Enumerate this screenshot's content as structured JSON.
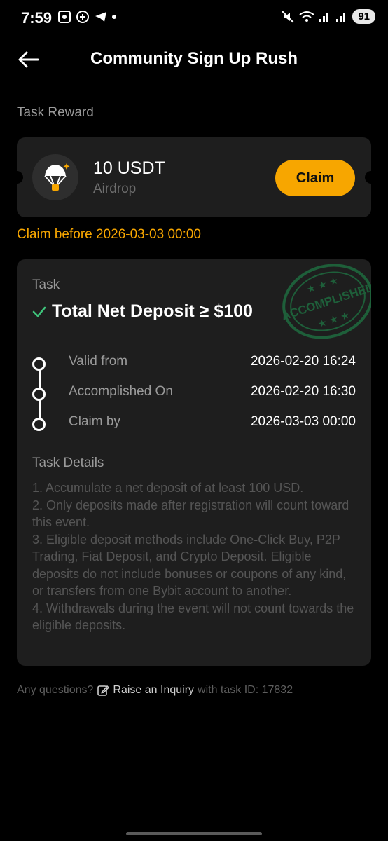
{
  "status_bar": {
    "time": "7:59",
    "battery": "91"
  },
  "header": {
    "title": "Community Sign Up Rush"
  },
  "reward": {
    "section_label": "Task Reward",
    "amount": "10 USDT",
    "type": "Airdrop",
    "claim_label": "Claim",
    "claim_before": "Claim before 2026-03-03 00:00",
    "icon": "parachute-airdrop-icon"
  },
  "task": {
    "label": "Task",
    "title": "Total Net Deposit ≥ $100",
    "stamp_text": "ACCOMPLISHED",
    "timeline": [
      {
        "label": "Valid from",
        "value": "2026-02-20 16:24"
      },
      {
        "label": "Accomplished On",
        "value": "2026-02-20 16:30"
      },
      {
        "label": "Claim by",
        "value": "2026-03-03 00:00"
      }
    ],
    "details_title": "Task Details",
    "details": [
      "1. Accumulate a net deposit of at least 100 USD.",
      "2. Only deposits made after registration will count toward this event.",
      "3. Eligible deposit methods include One-Click Buy, P2P Trading, Fiat Deposit, and Crypto Deposit. Eligible deposits do not include bonuses or coupons of any kind, or transfers from one Bybit account to another.",
      "4. Withdrawals during the event will not count towards the eligible deposits."
    ]
  },
  "footer": {
    "prefix": "Any questions?",
    "link": "Raise an Inquiry",
    "suffix": "with task ID: 17832"
  },
  "colors": {
    "accent": "#f7a600",
    "card": "#1e1e1e",
    "success": "#3ec27a",
    "stamp": "#1f6b3f"
  }
}
